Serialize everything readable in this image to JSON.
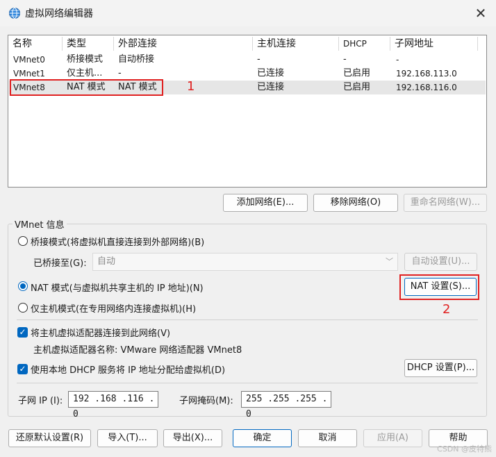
{
  "window": {
    "title": "虚拟网络编辑器",
    "close_glyph": "✕",
    "icon": "globe-network-icon"
  },
  "network_table": {
    "headers": [
      "名称",
      "类型",
      "外部连接",
      "主机连接",
      "DHCP",
      "子网地址"
    ],
    "rows": [
      {
        "name": "VMnet0",
        "type": "桥接模式",
        "external": "自动桥接",
        "host": "-",
        "dhcp": "-",
        "subnet": "-"
      },
      {
        "name": "VMnet1",
        "type": "仅主机...",
        "external": "-",
        "host": "已连接",
        "dhcp": "已启用",
        "subnet": "192.168.113.0"
      },
      {
        "name": "VMnet8",
        "type": "NAT 模式",
        "external": "NAT 模式",
        "host": "已连接",
        "dhcp": "已启用",
        "subnet": "192.168.116.0"
      }
    ],
    "selected_index": 2
  },
  "annotations": {
    "label_1": "1",
    "label_2": "2",
    "color": "#e02020"
  },
  "table_buttons": {
    "add": "添加网络(E)...",
    "remove": "移除网络(O)",
    "rename": "重命名网络(W)..."
  },
  "vmnet_info": {
    "group_title": "VMnet 信息",
    "bridge_radio": "桥接模式(将虚拟机直接连接到外部网络)(B)",
    "bridged_to_label": "已桥接至(G):",
    "bridged_to_value": "自动",
    "auto_settings": "自动设置(U)...",
    "nat_radio": "NAT 模式(与虚拟机共享主机的 IP 地址)(N)",
    "nat_settings": "NAT 设置(S)...",
    "hostonly_radio": "仅主机模式(在专用网络内连接虚拟机)(H)",
    "selected_mode": "nat",
    "connect_adapter_check": "将主机虚拟适配器连接到此网络(V)",
    "connect_adapter_checked": true,
    "adapter_name": "主机虚拟适配器名称: VMware 网络适配器 VMnet8",
    "dhcp_check": "使用本地 DHCP 服务将 IP 地址分配给虚拟机(D)",
    "dhcp_checked": true,
    "dhcp_settings": "DHCP 设置(P)...",
    "subnet_ip_label": "子网 IP (I):",
    "subnet_ip_value": "192 .168 .116 .  0",
    "subnet_mask_label": "子网掩码(M):",
    "subnet_mask_value": "255 .255 .255 .  0"
  },
  "footer_buttons": {
    "restore": "还原默认设置(R)",
    "import": "导入(T)...",
    "export": "导出(X)...",
    "ok": "确定",
    "cancel": "取消",
    "apply": "应用(A)",
    "help": "帮助"
  },
  "watermark": "CSDN @皮特熊",
  "colors": {
    "accent": "#0067c0",
    "annotation_red": "#e02020"
  }
}
